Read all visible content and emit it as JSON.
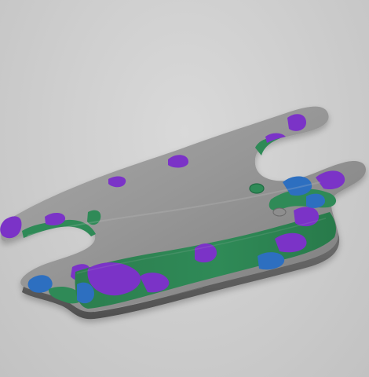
{
  "scene": {
    "object": "scanned-sheet-metal-bracket",
    "view": "3d-perspective",
    "palette": {
      "background": "#cfcfcf",
      "surface": "#8e8e8e",
      "surface_light": "#b5b5b5",
      "surface_dark": "#5f5f5f",
      "deviation_green": "#2f8a57",
      "deviation_blue": "#2d6fc0",
      "deviation_purple": "#7b33c7",
      "deviation_cyan": "#2f8a9e"
    }
  }
}
